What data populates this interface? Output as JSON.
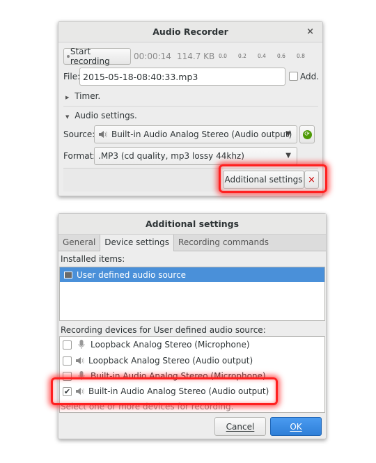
{
  "recorder": {
    "title": "Audio Recorder",
    "start_label": "Start recording",
    "elapsed": "00:00:14",
    "size": "114.7 KB",
    "level_ticks": [
      "0.0",
      "0.2",
      "0.4",
      "0.6",
      "0.8"
    ],
    "file_label": "File:",
    "file_value": "2015-05-18-08:40:33.mp3",
    "add_label": "Add.",
    "timer_label": "Timer.",
    "audio_settings_label": "Audio settings.",
    "source_label": "Source:",
    "source_value": "Built-in Audio Analog Stereo (Audio output)",
    "format_label": "Format:",
    "format_value": ".MP3  (cd quality, mp3 lossy 44khz)",
    "additional_button": "Additional settings",
    "close_glyph": "×",
    "close_additional_glyph": "×"
  },
  "additional": {
    "title": "Additional settings",
    "tabs": [
      "General",
      "Device settings",
      "Recording commands"
    ],
    "active_tab": "Device settings",
    "installed_label": "Installed items:",
    "installed_items": [
      "User defined audio source"
    ],
    "devices_label": "Recording devices for User defined audio source:",
    "devices": [
      {
        "label": "Loopback Analog Stereo (Microphone)",
        "checked": false,
        "icon": "microphone-icon"
      },
      {
        "label": "Loopback Analog Stereo (Audio output)",
        "checked": false,
        "icon": "speaker-icon"
      },
      {
        "label": "Built-in Audio Analog Stereo (Microphone)",
        "checked": false,
        "icon": "microphone-icon"
      },
      {
        "label": "Built-in Audio Analog Stereo (Audio output)",
        "checked": true,
        "icon": "speaker-icon"
      }
    ],
    "hint": "Select one or more devices for recording.",
    "cancel_label": "Cancel",
    "ok_label": "OK"
  },
  "colors": {
    "highlight": "#ff2020",
    "selection": "#4a90d9",
    "ok_button": "#3584e4",
    "refresh_icon": "#4e9a06"
  }
}
